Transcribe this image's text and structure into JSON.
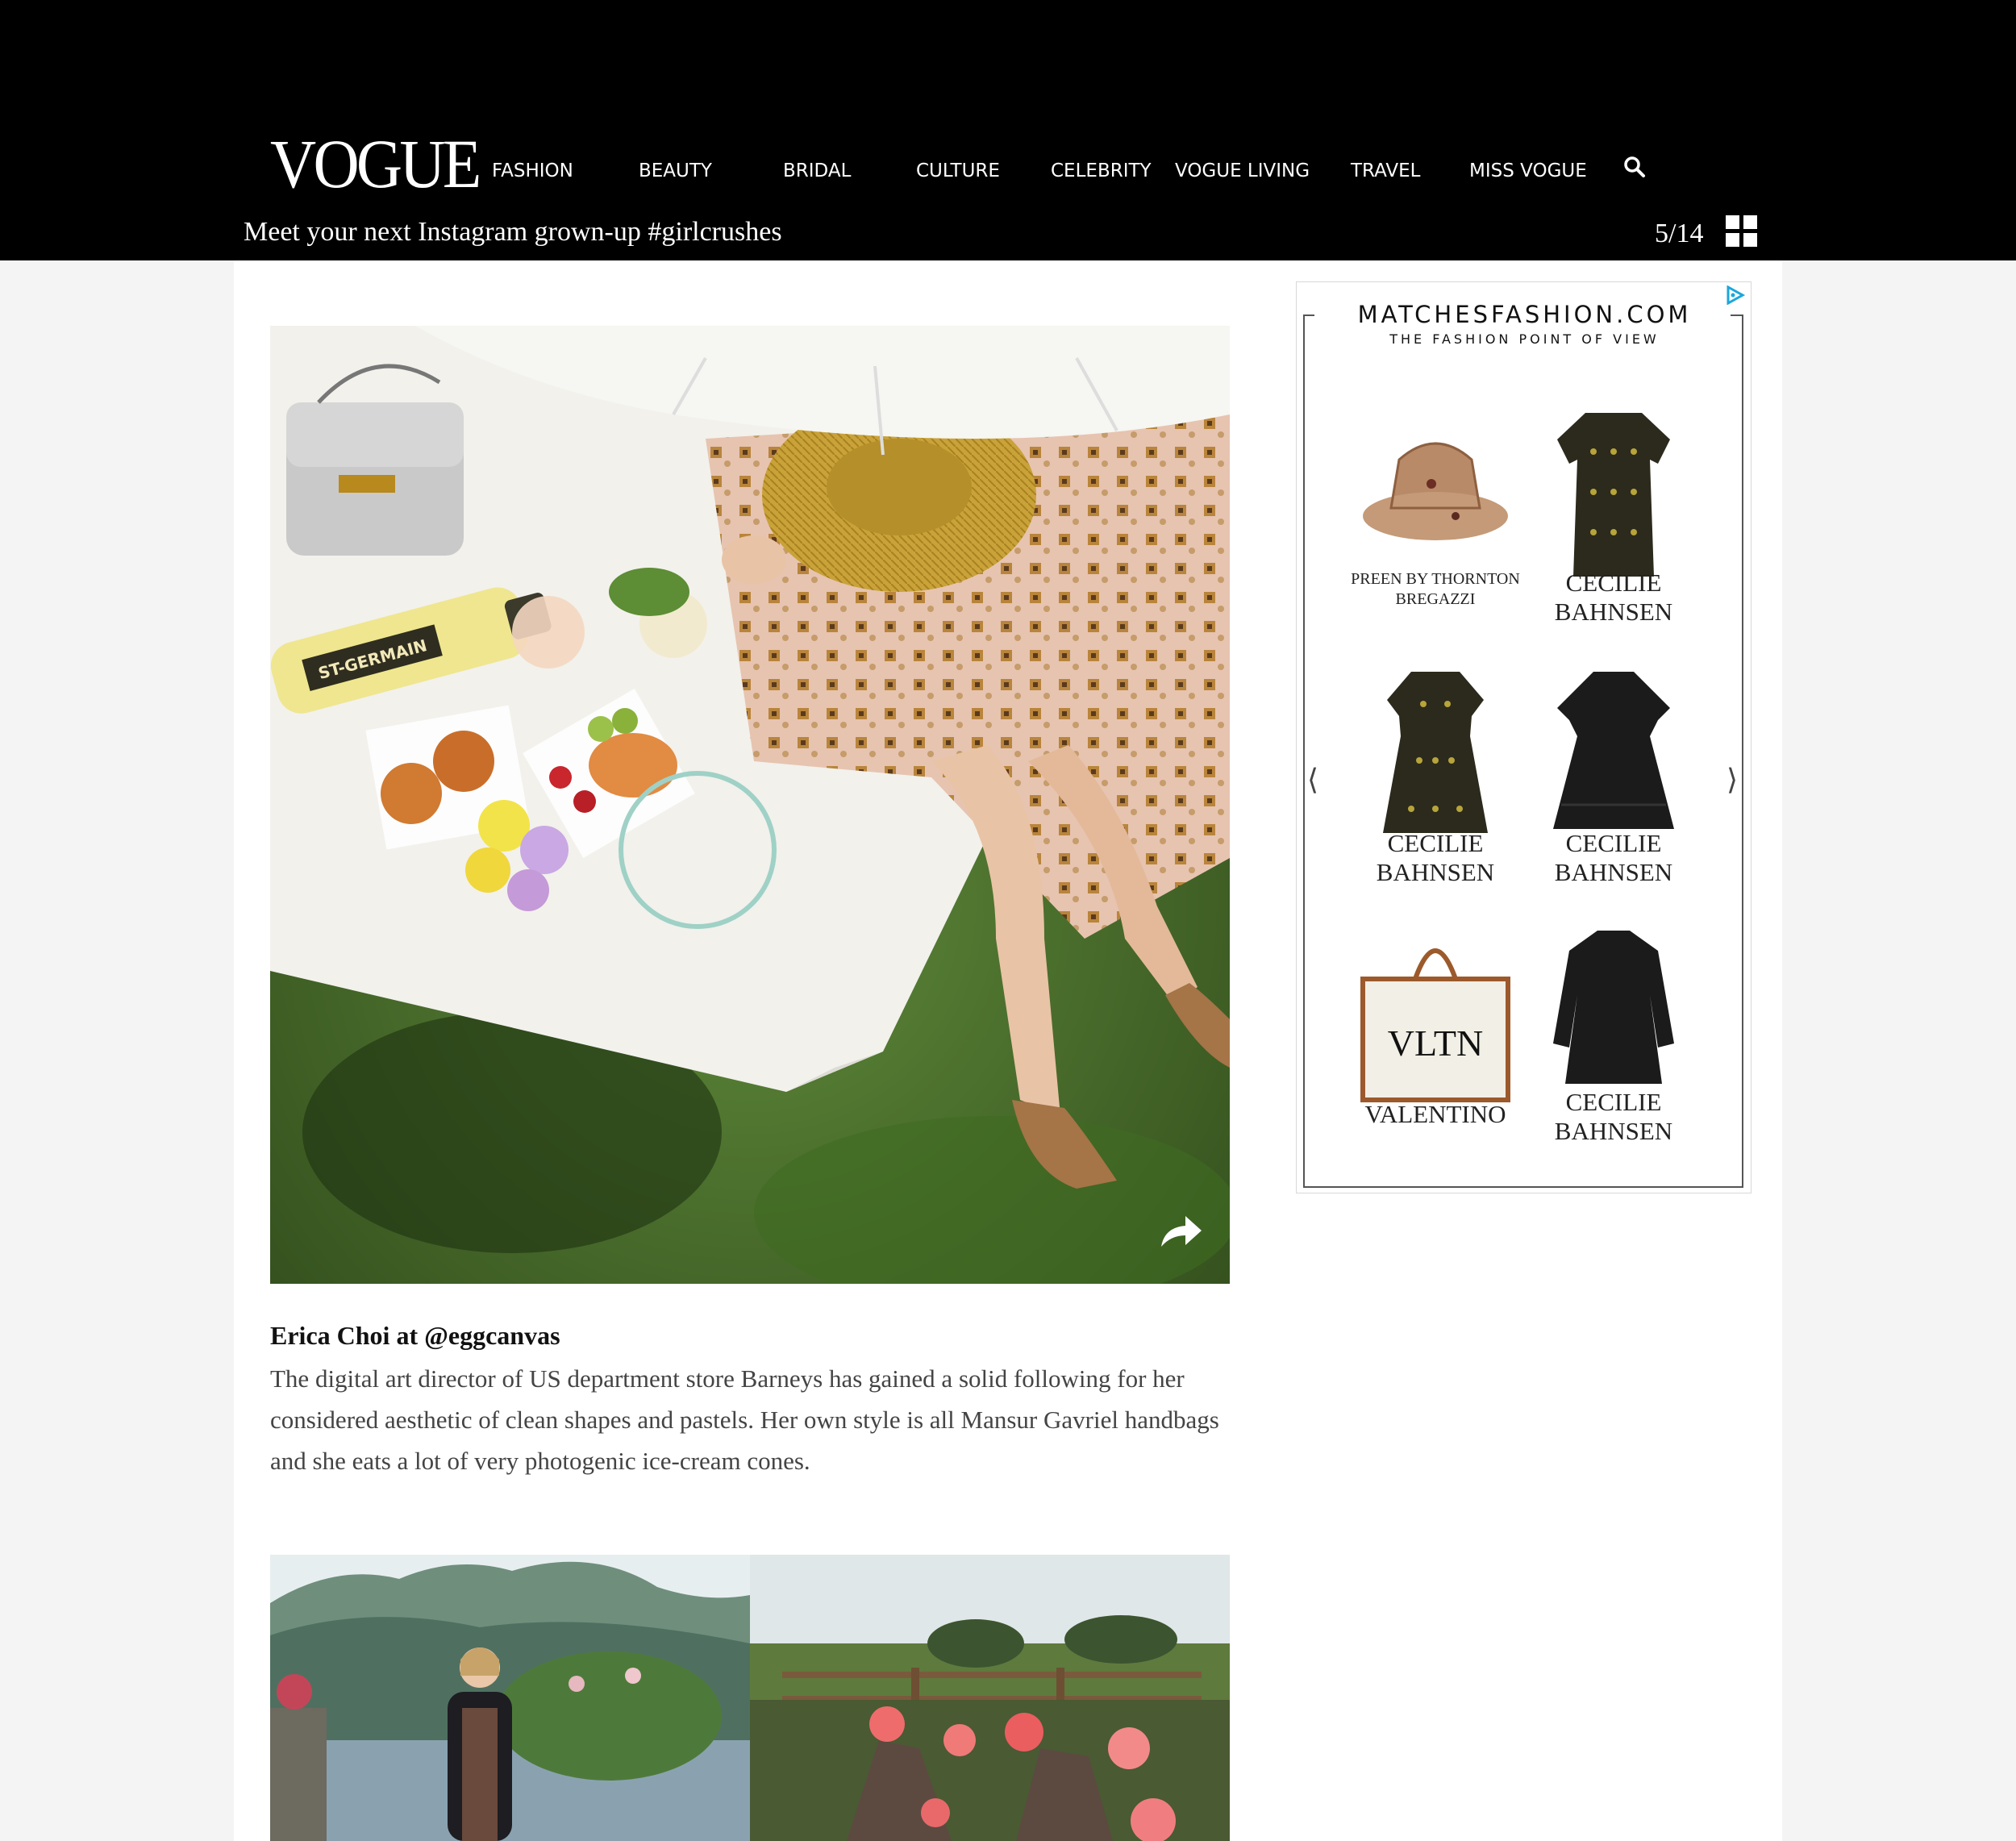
{
  "header": {
    "logo": "VOGUE",
    "nav": [
      "FASHION",
      "BEAUTY",
      "BRIDAL",
      "CULTURE",
      "CELEBRITY",
      "VOGUE LIVING",
      "TRAVEL",
      "MISS VOGUE"
    ],
    "search_icon": "search-icon"
  },
  "gallery": {
    "title": "Meet your next Instagram grown-up #girlcrushes",
    "counter": "5/14",
    "grid_icon": "grid-view-icon"
  },
  "slide": {
    "caption_name": "Erica Choi at @eggcanvas",
    "caption_text": "The digital art director of US department store Barneys has gained a solid following for her considered aesthetic of clean shapes and pastels. Her own style is all Mansur Gavriel handbags and she eats a lot of very photogenic ice-cream cones.",
    "image_text": "ST-GERMAIN",
    "share_icon": "share-icon"
  },
  "ad": {
    "brand": "MATCHESFASHION.COM",
    "tagline": "THE FASHION POINT OF VIEW",
    "products": [
      {
        "label": "PREEN BY THORNTON BREGAZZI",
        "item": "bucket hat"
      },
      {
        "label": "CECILIE BAHNSEN",
        "item": "dress"
      },
      {
        "label": "CECILIE BAHNSEN",
        "item": "dress"
      },
      {
        "label": "CECILIE BAHNSEN",
        "item": "dress"
      },
      {
        "label": "VALENTINO",
        "item": "tote bag",
        "bag_text": "VLTN"
      },
      {
        "label": "CECILIE BAHNSEN",
        "item": "dress"
      }
    ],
    "prev": "⟨",
    "next": "⟩",
    "adchoices_icon": "adchoices-icon"
  },
  "colors": {
    "header_bg": "#000000",
    "page_bg": "#f4f4f4",
    "content_bg": "#ffffff",
    "adchoices": "#1aa7dc"
  }
}
